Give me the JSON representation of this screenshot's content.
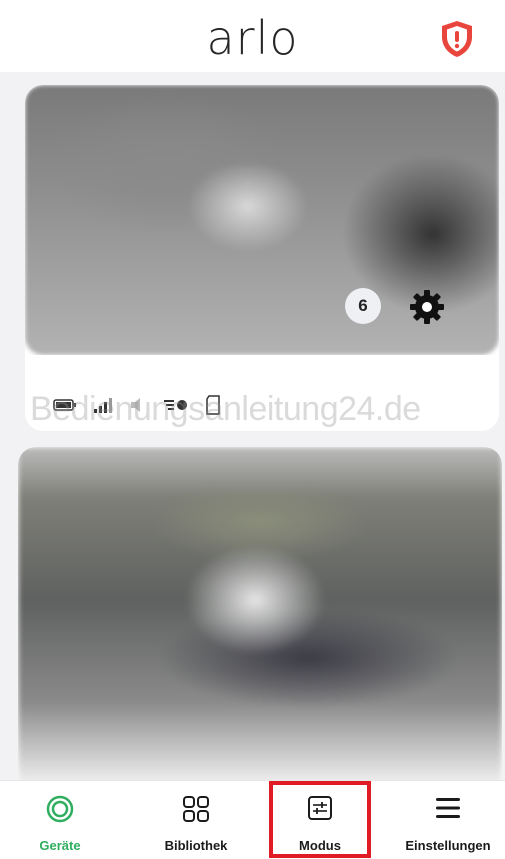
{
  "header": {
    "logo_text": "arlo",
    "alert_icon": "shield-alert-icon",
    "alert_color": "#e8453c"
  },
  "cameras": [
    {
      "status_icons": [
        "battery-icon",
        "signal-icon",
        "speaker-muted-icon",
        "motion-sensitivity-icon",
        "sd-card-icon"
      ],
      "event_count": "6",
      "settings_icon": "gear-icon"
    },
    {}
  ],
  "watermark": "Bedienungsanleitung24.de",
  "tabbar": {
    "tabs": [
      {
        "label": "Geräte",
        "icon": "devices-icon",
        "active": true
      },
      {
        "label": "Bibliothek",
        "icon": "library-grid-icon",
        "active": false
      },
      {
        "label": "Modus",
        "icon": "mode-sliders-icon",
        "active": false
      },
      {
        "label": "Einstellungen",
        "icon": "menu-icon",
        "active": false
      }
    ],
    "active_color": "#2fae5f"
  },
  "highlight_color": "#e01b23"
}
